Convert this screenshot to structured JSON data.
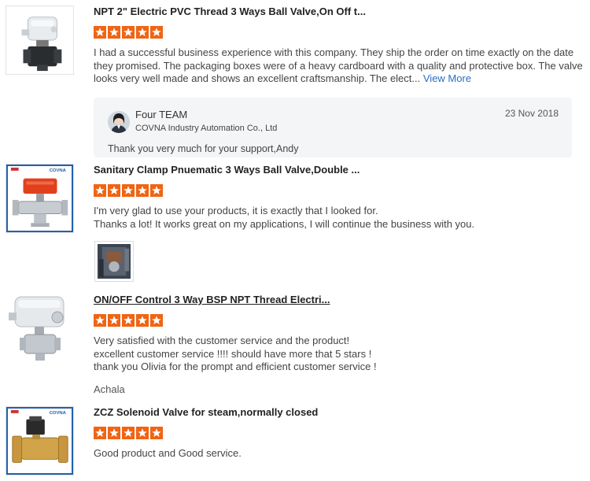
{
  "reviews": [
    {
      "title": "NPT 2\" Electric PVC Thread 3 Ways Ball Valve,On Off t...",
      "rating": 5,
      "lines": [
        "I had a successful business experience with this company. They ship the order on time exactly on the date",
        "they promised. The packaging boxes were of a heavy cardboard with a quality and protective box. The valve",
        "looks very well made and shows an excellent craftsmanship. The elect..."
      ],
      "view_more": "View More",
      "reply": {
        "name": "Four TEAM",
        "company": "COVNA Industry Automation Co., Ltd",
        "date": "23 Nov 2018",
        "message": "Thank you very much for your support,Andy"
      }
    },
    {
      "title": "Sanitary Clamp Pnuematic 3 Ways Ball Valve,Double ...",
      "rating": 5,
      "lines": [
        "I'm very glad to use your products, it is exactly that I looked for.",
        "Thanks a lot! It works great on my applications, I will continue the business with you."
      ],
      "brand_label": "COVNA"
    },
    {
      "title": "ON/OFF Control 3 Way BSP NPT Thread Electri...",
      "rating": 5,
      "lines": [
        "Very satisfied with the customer service and the product!",
        "excellent customer service !!!! should have more that 5 stars !",
        "thank you Olivia  for the prompt and efficient customer service !"
      ],
      "signature": "Achala"
    },
    {
      "title": "ZCZ Solenoid Valve for steam,normally closed",
      "rating": 5,
      "lines": [
        "Good product and Good service."
      ],
      "brand_label": "COVNA"
    }
  ],
  "colors": {
    "star": "#f06414",
    "link": "#2b6cc4",
    "reply_bg": "#f4f5f6"
  }
}
